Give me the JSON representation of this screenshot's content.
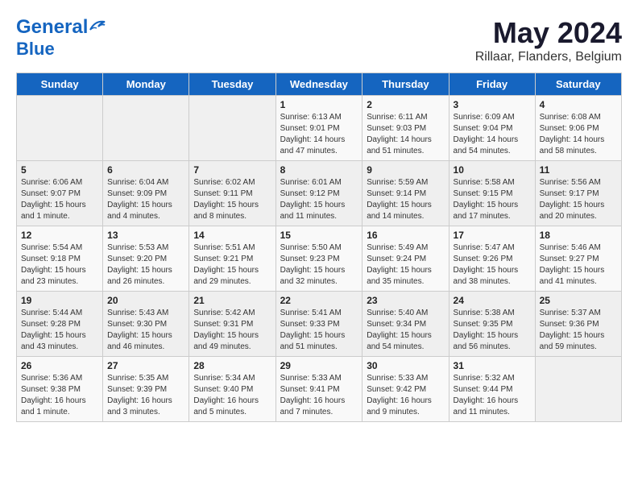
{
  "title": "May 2024",
  "subtitle": "Rillaar, Flanders, Belgium",
  "logo_line1": "General",
  "logo_line2": "Blue",
  "days_of_week": [
    "Sunday",
    "Monday",
    "Tuesday",
    "Wednesday",
    "Thursday",
    "Friday",
    "Saturday"
  ],
  "weeks": [
    [
      {
        "day": "",
        "info": ""
      },
      {
        "day": "",
        "info": ""
      },
      {
        "day": "",
        "info": ""
      },
      {
        "day": "1",
        "info": "Sunrise: 6:13 AM\nSunset: 9:01 PM\nDaylight: 14 hours\nand 47 minutes."
      },
      {
        "day": "2",
        "info": "Sunrise: 6:11 AM\nSunset: 9:03 PM\nDaylight: 14 hours\nand 51 minutes."
      },
      {
        "day": "3",
        "info": "Sunrise: 6:09 AM\nSunset: 9:04 PM\nDaylight: 14 hours\nand 54 minutes."
      },
      {
        "day": "4",
        "info": "Sunrise: 6:08 AM\nSunset: 9:06 PM\nDaylight: 14 hours\nand 58 minutes."
      }
    ],
    [
      {
        "day": "5",
        "info": "Sunrise: 6:06 AM\nSunset: 9:07 PM\nDaylight: 15 hours\nand 1 minute."
      },
      {
        "day": "6",
        "info": "Sunrise: 6:04 AM\nSunset: 9:09 PM\nDaylight: 15 hours\nand 4 minutes."
      },
      {
        "day": "7",
        "info": "Sunrise: 6:02 AM\nSunset: 9:11 PM\nDaylight: 15 hours\nand 8 minutes."
      },
      {
        "day": "8",
        "info": "Sunrise: 6:01 AM\nSunset: 9:12 PM\nDaylight: 15 hours\nand 11 minutes."
      },
      {
        "day": "9",
        "info": "Sunrise: 5:59 AM\nSunset: 9:14 PM\nDaylight: 15 hours\nand 14 minutes."
      },
      {
        "day": "10",
        "info": "Sunrise: 5:58 AM\nSunset: 9:15 PM\nDaylight: 15 hours\nand 17 minutes."
      },
      {
        "day": "11",
        "info": "Sunrise: 5:56 AM\nSunset: 9:17 PM\nDaylight: 15 hours\nand 20 minutes."
      }
    ],
    [
      {
        "day": "12",
        "info": "Sunrise: 5:54 AM\nSunset: 9:18 PM\nDaylight: 15 hours\nand 23 minutes."
      },
      {
        "day": "13",
        "info": "Sunrise: 5:53 AM\nSunset: 9:20 PM\nDaylight: 15 hours\nand 26 minutes."
      },
      {
        "day": "14",
        "info": "Sunrise: 5:51 AM\nSunset: 9:21 PM\nDaylight: 15 hours\nand 29 minutes."
      },
      {
        "day": "15",
        "info": "Sunrise: 5:50 AM\nSunset: 9:23 PM\nDaylight: 15 hours\nand 32 minutes."
      },
      {
        "day": "16",
        "info": "Sunrise: 5:49 AM\nSunset: 9:24 PM\nDaylight: 15 hours\nand 35 minutes."
      },
      {
        "day": "17",
        "info": "Sunrise: 5:47 AM\nSunset: 9:26 PM\nDaylight: 15 hours\nand 38 minutes."
      },
      {
        "day": "18",
        "info": "Sunrise: 5:46 AM\nSunset: 9:27 PM\nDaylight: 15 hours\nand 41 minutes."
      }
    ],
    [
      {
        "day": "19",
        "info": "Sunrise: 5:44 AM\nSunset: 9:28 PM\nDaylight: 15 hours\nand 43 minutes."
      },
      {
        "day": "20",
        "info": "Sunrise: 5:43 AM\nSunset: 9:30 PM\nDaylight: 15 hours\nand 46 minutes."
      },
      {
        "day": "21",
        "info": "Sunrise: 5:42 AM\nSunset: 9:31 PM\nDaylight: 15 hours\nand 49 minutes."
      },
      {
        "day": "22",
        "info": "Sunrise: 5:41 AM\nSunset: 9:33 PM\nDaylight: 15 hours\nand 51 minutes."
      },
      {
        "day": "23",
        "info": "Sunrise: 5:40 AM\nSunset: 9:34 PM\nDaylight: 15 hours\nand 54 minutes."
      },
      {
        "day": "24",
        "info": "Sunrise: 5:38 AM\nSunset: 9:35 PM\nDaylight: 15 hours\nand 56 minutes."
      },
      {
        "day": "25",
        "info": "Sunrise: 5:37 AM\nSunset: 9:36 PM\nDaylight: 15 hours\nand 59 minutes."
      }
    ],
    [
      {
        "day": "26",
        "info": "Sunrise: 5:36 AM\nSunset: 9:38 PM\nDaylight: 16 hours\nand 1 minute."
      },
      {
        "day": "27",
        "info": "Sunrise: 5:35 AM\nSunset: 9:39 PM\nDaylight: 16 hours\nand 3 minutes."
      },
      {
        "day": "28",
        "info": "Sunrise: 5:34 AM\nSunset: 9:40 PM\nDaylight: 16 hours\nand 5 minutes."
      },
      {
        "day": "29",
        "info": "Sunrise: 5:33 AM\nSunset: 9:41 PM\nDaylight: 16 hours\nand 7 minutes."
      },
      {
        "day": "30",
        "info": "Sunrise: 5:33 AM\nSunset: 9:42 PM\nDaylight: 16 hours\nand 9 minutes."
      },
      {
        "day": "31",
        "info": "Sunrise: 5:32 AM\nSunset: 9:44 PM\nDaylight: 16 hours\nand 11 minutes."
      },
      {
        "day": "",
        "info": ""
      }
    ]
  ]
}
